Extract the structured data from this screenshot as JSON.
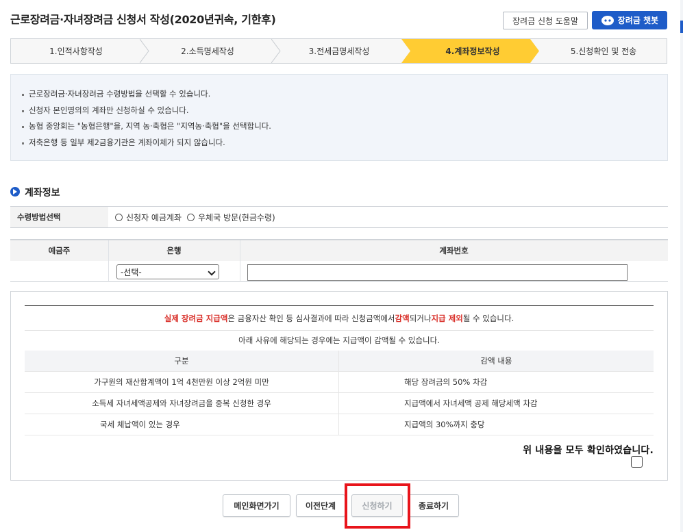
{
  "header": {
    "title": "근로장려금·자녀장려금 신청서 작성(2020년귀속, 기한후)",
    "help_button": "장려금 신청 도움말",
    "chatbot_button": "장려금 챗봇"
  },
  "steps": [
    {
      "label": "1.인적사항작성",
      "active": false
    },
    {
      "label": "2.소득명세작성",
      "active": false
    },
    {
      "label": "3.전세금명세작성",
      "active": false
    },
    {
      "label": "4.계좌정보작성",
      "active": true
    },
    {
      "label": "5.신청확인 및 전송",
      "active": false
    }
  ],
  "info_items": [
    "근로장려금·자녀장려금 수령방법을 선택할 수 있습니다.",
    "신청자 본인명의의 계좌만 신청하실 수 있습니다.",
    "농협 중앙회는 \"농협은행\"을, 지역 농·축협은 \"지역농·축협\"을 선택합니다.",
    "저축은행 등 일부 제2금융기관은 계좌이체가 되지 않습니다."
  ],
  "account_section": {
    "title": "계좌정보",
    "method_label": "수령방법선택",
    "method_options": [
      "신청자 예금계좌",
      "우체국 방문(현금수령)"
    ],
    "columns": [
      "예금주",
      "은행",
      "계좌번호"
    ],
    "bank_select_value": "-선택-",
    "account_number_value": ""
  },
  "notice": {
    "line1_parts": [
      {
        "text": "실제 장려금 지급액",
        "red": true
      },
      {
        "text": "은 금융자산 확인 등 심사결과에 따라 신청금액에서 ",
        "red": false
      },
      {
        "text": "감액",
        "red": true
      },
      {
        "text": "되거나 ",
        "red": false
      },
      {
        "text": "지급 제외",
        "red": true
      },
      {
        "text": "될 수 있습니다.",
        "red": false
      }
    ],
    "line2": "아래 사유에 해당되는 경우에는 지급액이 감액될 수 있습니다.",
    "table_headers": [
      "구분",
      "감액 내용"
    ],
    "table_rows": [
      [
        "가구원의 재산합계액이 1억 4천만원 이상 2억원 미만",
        "해당 장려금의 50% 차감"
      ],
      [
        "소득세 자녀세액공제와 자녀장려금을 중복 신청한 경우",
        "지급액에서 자녀세액 공제 해당세액 차감"
      ],
      [
        "국세 체납액이 있는 경우",
        "지급액의 30%까지 충당"
      ]
    ],
    "confirm_text": "위 내용을 모두 확인하였습니다."
  },
  "buttons": {
    "main": "메인화면가기",
    "prev": "이전단계",
    "apply": "신청하기",
    "exit": "종료하기"
  },
  "colors": {
    "accent": "#1e5cc8",
    "active_step": "#ffcc33",
    "warning_red": "#d9302a",
    "highlight_box": "#e8141b"
  }
}
